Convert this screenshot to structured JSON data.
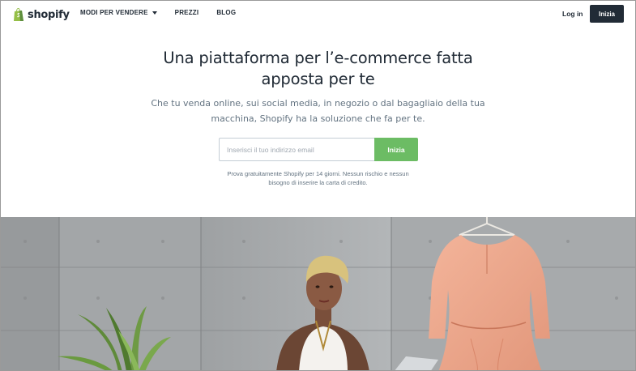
{
  "brand": {
    "name": "shopify",
    "color": "#95bf47"
  },
  "nav": {
    "links": [
      {
        "label": "MODI PER VENDERE",
        "has_dropdown": true
      },
      {
        "label": "PREZZI",
        "has_dropdown": false
      },
      {
        "label": "BLOG",
        "has_dropdown": false
      }
    ],
    "login_label": "Log in",
    "start_label": "Inizia"
  },
  "hero": {
    "title_line1": "Una piattaforma per l’e-commerce fatta",
    "title_line2": "apposta per te",
    "subtitle_line1": "Che tu venda online, sui social media, in negozio o dal bagagliaio della tua",
    "subtitle_line2": "macchina, Shopify ha la soluzione che fa per te."
  },
  "signup": {
    "email_placeholder": "Inserisci il tuo indirizzo email",
    "email_value": "",
    "submit_label": "Inizia",
    "submit_color": "#6cbc64",
    "legal_line1": "Prova gratuitamente Shopify per 14 giorni. Nessun rischio e nessun",
    "legal_line2": "bisogno di inserire la carta di credito."
  },
  "colors": {
    "text": "#212b36",
    "muted": "#637381",
    "dark_button": "#212b36"
  }
}
